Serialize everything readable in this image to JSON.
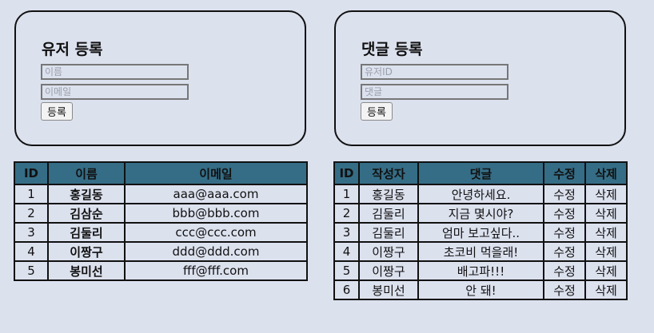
{
  "user_form": {
    "title": "유저 등록",
    "name_placeholder": "이름",
    "email_placeholder": "이메일",
    "submit_label": "등록"
  },
  "comment_form": {
    "title": "댓글 등록",
    "userid_placeholder": "유저ID",
    "comment_placeholder": "댓글",
    "submit_label": "등록"
  },
  "users_table": {
    "headers": [
      "ID",
      "이름",
      "이메일"
    ],
    "rows": [
      {
        "id": "1",
        "name": "홍길동",
        "email": "aaa@aaa.com"
      },
      {
        "id": "2",
        "name": "김삼순",
        "email": "bbb@bbb.com"
      },
      {
        "id": "3",
        "name": "김둘리",
        "email": "ccc@ccc.com"
      },
      {
        "id": "4",
        "name": "이짱구",
        "email": "ddd@ddd.com"
      },
      {
        "id": "5",
        "name": "봉미선",
        "email": "fff@fff.com"
      }
    ]
  },
  "comments_table": {
    "headers": [
      "ID",
      "작성자",
      "댓글",
      "수정",
      "삭제"
    ],
    "rows": [
      {
        "id": "1",
        "author": "홍길동",
        "comment": "안녕하세요.",
        "edit": "수정",
        "delete": "삭제"
      },
      {
        "id": "2",
        "author": "김둘리",
        "comment": "지금 몇시야?",
        "edit": "수정",
        "delete": "삭제"
      },
      {
        "id": "3",
        "author": "김둘리",
        "comment": "엄마 보고싶다..",
        "edit": "수정",
        "delete": "삭제"
      },
      {
        "id": "4",
        "author": "이짱구",
        "comment": "초코비 먹을래!",
        "edit": "수정",
        "delete": "삭제"
      },
      {
        "id": "5",
        "author": "이짱구",
        "comment": "배고파!!!",
        "edit": "수정",
        "delete": "삭제"
      },
      {
        "id": "6",
        "author": "봉미선",
        "comment": "안 돼!",
        "edit": "수정",
        "delete": "삭제"
      }
    ]
  },
  "colors": {
    "background": "#dce1ee",
    "table_header": "#356d86"
  }
}
